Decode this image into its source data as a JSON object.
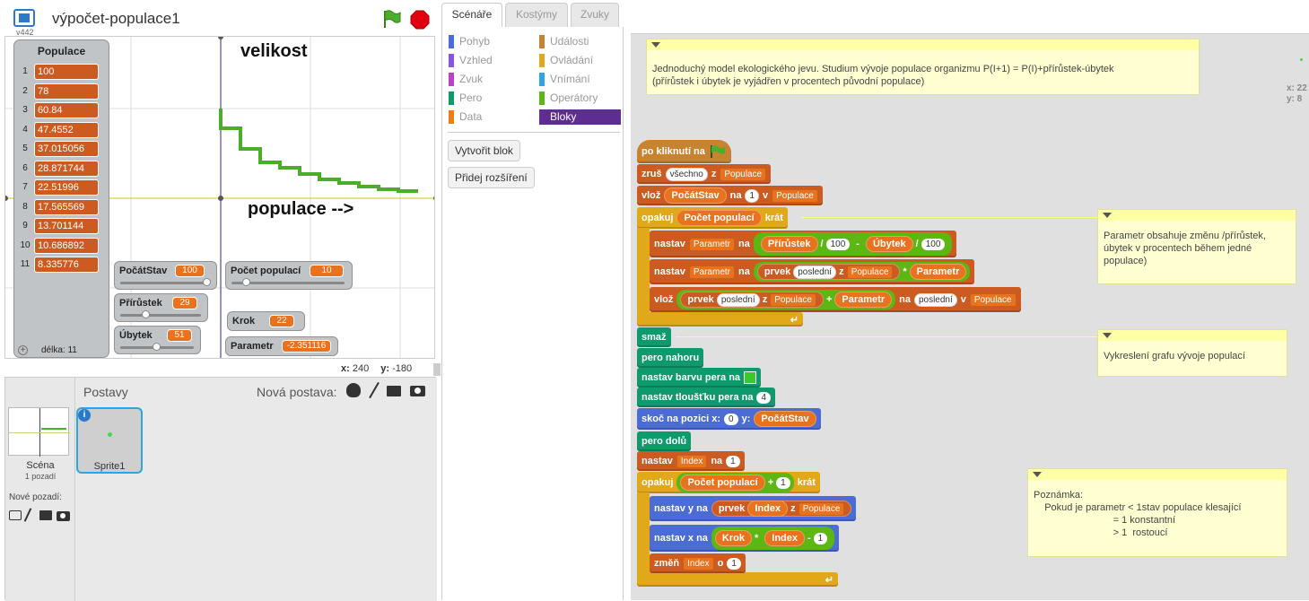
{
  "project": {
    "title": "výpočet-populace1",
    "version": "v442"
  },
  "stage": {
    "text_velikost": "velikost",
    "text_populace": "populace -->",
    "coords": {
      "x_label": "x:",
      "x": "240",
      "y_label": "y:",
      "y": "-180"
    }
  },
  "list_monitor": {
    "title": "Populace",
    "items": [
      "100",
      "78",
      "60.84",
      "47.4552",
      "37.015056",
      "28.871744",
      "22.51996",
      "17.565569",
      "13.701144",
      "10.686892",
      "8.335776"
    ],
    "length_label": "délka: 11"
  },
  "monitors": {
    "pocatstav": {
      "label": "PočátStav",
      "value": "100"
    },
    "pocet_populaci": {
      "label": "Počet populací",
      "value": "10"
    },
    "prirustek": {
      "label": "Přírůstek",
      "value": "29"
    },
    "ubytek": {
      "label": "Úbytek",
      "value": "51"
    },
    "krok": {
      "label": "Krok",
      "value": "22"
    },
    "parametr": {
      "label": "Parametr",
      "value": "-2.351116"
    }
  },
  "sprites": {
    "header": "Postavy",
    "new_sprite": "Nová postava:",
    "scene_label": "Scéna",
    "scene_sub": "1 pozadí",
    "new_backdrop": "Nové pozadí:",
    "sprite_name": "Sprite1"
  },
  "tabs": [
    "Scénáře",
    "Kostýmy",
    "Zvuky"
  ],
  "categories": {
    "left": [
      "Pohyb",
      "Vzhled",
      "Zvuk",
      "Pero",
      "Data"
    ],
    "right": [
      "Události",
      "Ovládání",
      "Vnímání",
      "Operátory",
      "Bloky"
    ],
    "colors_left": [
      "#4a6cd4",
      "#8a55d7",
      "#bb42c3",
      "#0e9a6c",
      "#ee7d16"
    ],
    "colors_right": [
      "#c88330",
      "#e1a91a",
      "#2ca5e2",
      "#5cb712",
      "#632d99"
    ]
  },
  "palette_buttons": {
    "make_block": "Vytvořit blok",
    "add_extension": "Přidej rozšíření"
  },
  "cursor": {
    "x": "x: 22",
    "y": "y: 8"
  },
  "notes": {
    "n1": "Jednoduchý model ekologického jevu. Studium vývoje populace organizmu P(I+1) = P(I)+přírůstek-úbytek\n(přírůstek i úbytek je vyjádřen v procentech původní populace)",
    "n2": "Parametr obsahuje změnu /přírůstek,\núbytek v procentech během jedné\npopulace)",
    "n3": "Vykreslení grafu vývoje populací",
    "n4": "Poznámka:\n    Pokud je parametr < 1stav populace klesající\n                             = 1 konstantní\n                             > 1  rostoucí"
  },
  "script": {
    "hat": "po kliknutí na",
    "delete_all": "zruš",
    "all": "všechno",
    "from": "z",
    "list": "Populace",
    "insert": "vlož",
    "pocatstav": "PočátStav",
    "at": "na",
    "one": "1",
    "in": "v",
    "repeat": "opakuj",
    "pocet_populaci": "Počet populací",
    "times": "krát",
    "set": "nastav",
    "parametr": "Parametr",
    "to": "na",
    "prirustek": "Přírůstek",
    "div": "/",
    "hundred": "100",
    "minus": "-",
    "ubytek": "Úbytek",
    "item": "prvek",
    "last": "poslední",
    "times_op": "*",
    "plus": "+",
    "clear": "smaž",
    "pen_up": "pero nahoru",
    "set_pen_color": "nastav barvu pera na",
    "set_pen_size": "nastav tloušťku pera na",
    "four": "4",
    "goto": "skoč na pozici x:",
    "zero": "0",
    "y": "y:",
    "pen_down": "pero dolů",
    "index": "Index",
    "set_y": "nastav y na",
    "set_x": "nastav x na",
    "krok": "Krok",
    "change": "změň",
    "by": "o"
  }
}
